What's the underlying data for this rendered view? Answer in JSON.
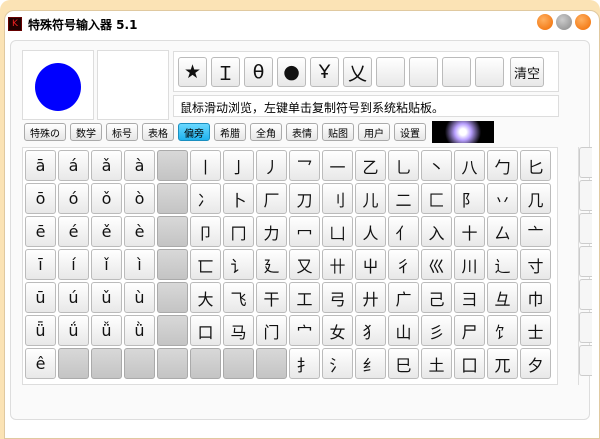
{
  "window": {
    "title": "特殊符号输入器 5.1",
    "logo": "KE"
  },
  "recent": [
    "★",
    "Ｉ",
    "θ",
    "●",
    "Ұ",
    "乂",
    "",
    "",
    "",
    ""
  ],
  "clear_label": "清空",
  "hint": "鼠标滑动浏览，左键单击复制符号到系统粘贴板。",
  "tabs": [
    "特殊の",
    "数学",
    "标号",
    "表格",
    "偏旁",
    "希腊",
    "全角",
    "表情",
    "贴图",
    "用户",
    "设置"
  ],
  "active_tab": "偏旁",
  "colors": {
    "preview_dot": "#0000ff",
    "active_tab": "#1fb2ee"
  },
  "grid": [
    [
      "ā",
      "á",
      "ǎ",
      "à",
      "",
      "丨",
      "亅",
      "丿",
      "乛",
      "一",
      "乙",
      "乚",
      "丶",
      "八",
      "勹",
      "匕"
    ],
    [
      "ō",
      "ó",
      "ǒ",
      "ò",
      "",
      "冫",
      "卜",
      "厂",
      "刀",
      "刂",
      "儿",
      "二",
      "匚",
      "阝",
      "丷",
      "几"
    ],
    [
      "ē",
      "é",
      "ě",
      "è",
      "",
      "卩",
      "冂",
      "力",
      "冖",
      "凵",
      "人",
      "亻",
      "入",
      "十",
      "厶",
      "亠"
    ],
    [
      "ī",
      "í",
      "ǐ",
      "ì",
      "",
      "匸",
      "讠",
      "廴",
      "又",
      "卄",
      "屮",
      "彳",
      "巛",
      "川",
      "辶",
      "寸"
    ],
    [
      "ū",
      "ú",
      "ǔ",
      "ù",
      "",
      "大",
      "飞",
      "干",
      "工",
      "弓",
      "廾",
      "广",
      "己",
      "彐",
      "彑",
      "巾"
    ],
    [
      "ǖ",
      "ǘ",
      "ǚ",
      "ǜ",
      "",
      "口",
      "马",
      "门",
      "宀",
      "女",
      "犭",
      "山",
      "彡",
      "尸",
      "饣",
      "士"
    ],
    [
      "ê",
      "",
      "",
      "",
      "",
      "",
      "",
      "",
      "扌",
      "氵",
      "纟",
      "巳",
      "土",
      "囗",
      "兀",
      "夕"
    ]
  ]
}
